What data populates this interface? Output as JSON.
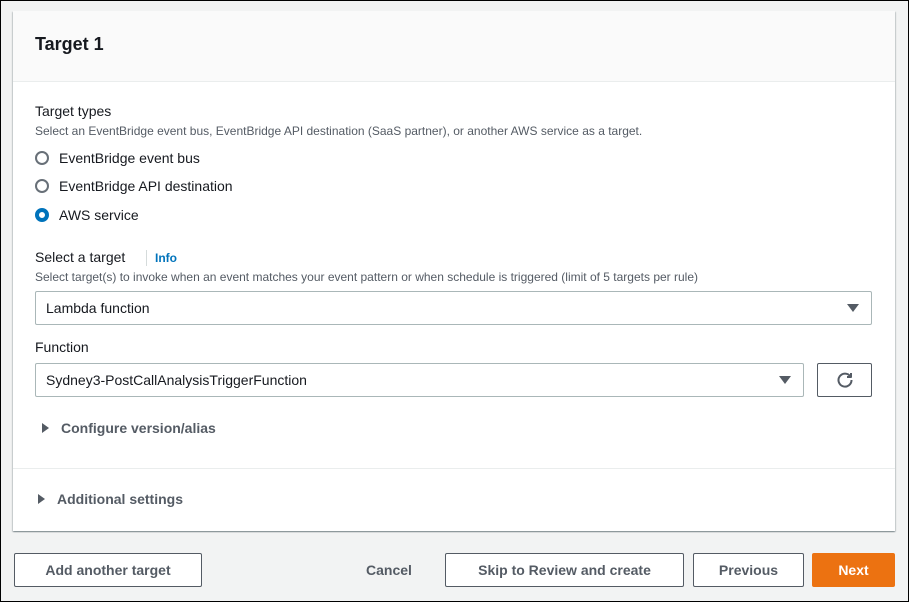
{
  "panel": {
    "title": "Target 1"
  },
  "target_types": {
    "label": "Target types",
    "description": "Select an EventBridge event bus, EventBridge API destination (SaaS partner), or another AWS service as a target.",
    "options": [
      {
        "label": "EventBridge event bus",
        "checked": false
      },
      {
        "label": "EventBridge API destination",
        "checked": false
      },
      {
        "label": "AWS service",
        "checked": true
      }
    ]
  },
  "select_target": {
    "label": "Select a target",
    "info": "Info",
    "description": "Select target(s) to invoke when an event matches your event pattern or when schedule is triggered (limit of 5 targets per rule)",
    "value": "Lambda function"
  },
  "function": {
    "label": "Function",
    "value": "Sydney3-PostCallAnalysisTriggerFunction"
  },
  "configure_version": {
    "label": "Configure version/alias"
  },
  "additional_settings": {
    "label": "Additional settings"
  },
  "footer": {
    "add_target": "Add another target",
    "cancel": "Cancel",
    "skip": "Skip to Review and create",
    "previous": "Previous",
    "next": "Next"
  },
  "colors": {
    "primary": "#ec7211",
    "link": "#0073bb",
    "radio_selected": "#0073bb"
  },
  "icons": {
    "refresh": "refresh-icon",
    "caret": "caret-down-icon",
    "expand": "caret-right-icon"
  }
}
